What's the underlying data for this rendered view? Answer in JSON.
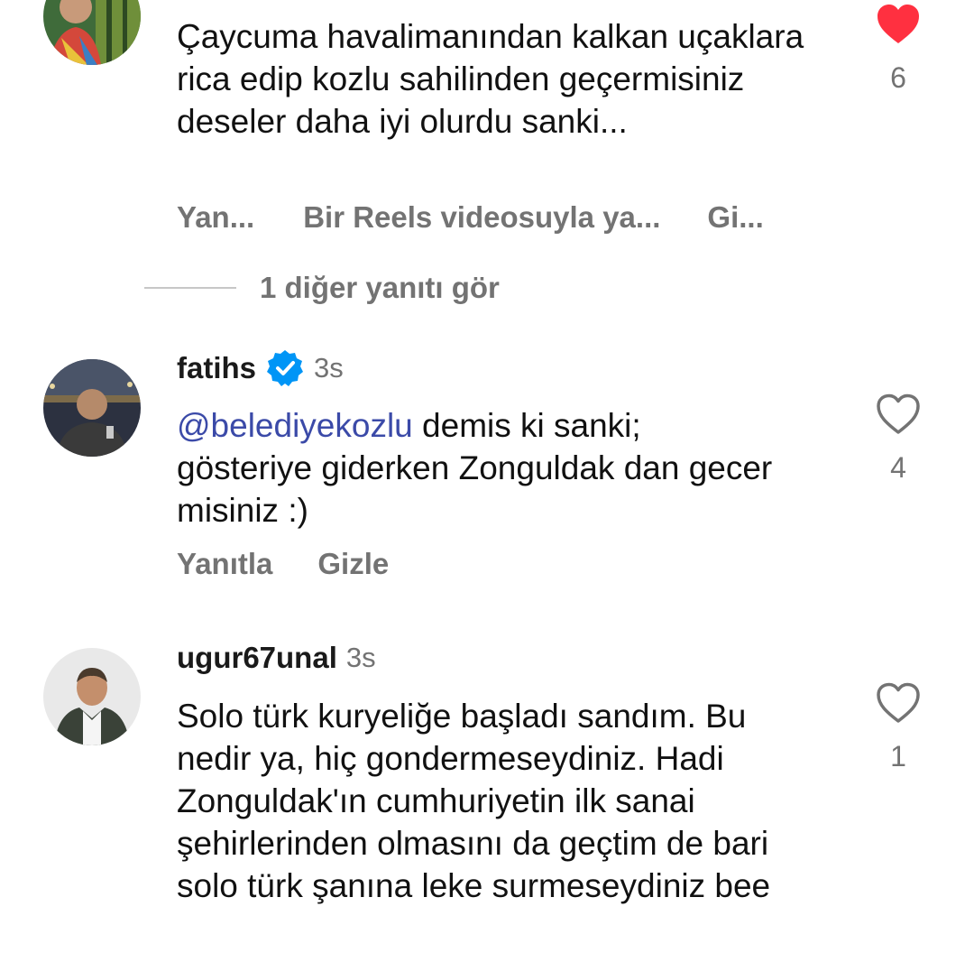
{
  "comments": [
    {
      "username": "",
      "time": "",
      "text": "Çaycuma havalimanından kalkan uçaklara rica edip kozlu sahilinden geçermisiniz deseler daha iyi olurdu sanki...",
      "liked": true,
      "like_count": "6",
      "actions": [
        "Yan...",
        "Bir Reels videosuyla ya...",
        "Gi..."
      ]
    },
    {
      "username": "fatihs",
      "verified": true,
      "time": "3s",
      "mention": "@belediyekozlu",
      "text": " demis ki sanki;\ngösteriye giderken Zonguldak dan gecer misiniz :)",
      "liked": false,
      "like_count": "4",
      "actions": [
        "Yanıtla",
        "Gizle"
      ]
    },
    {
      "username": "ugur67unal",
      "time": "3s",
      "text": "Solo türk kuryeliğe başladı sandım. Bu nedir ya, hiç gondermeseydiniz. Hadi Zonguldak'ın cumhuriyetin ilk sanai  şehirlerinden olmasını da geçtim de bari solo türk şanına leke surmeseydiniz bee",
      "liked": false,
      "like_count": "1"
    }
  ],
  "view_replies_label": "1 diğer yanıtı gör",
  "colors": {
    "heart_liked": "#ff3040",
    "mention": "#3b4aa8",
    "secondary_text": "#737373",
    "verified_badge": "#0095f6"
  }
}
